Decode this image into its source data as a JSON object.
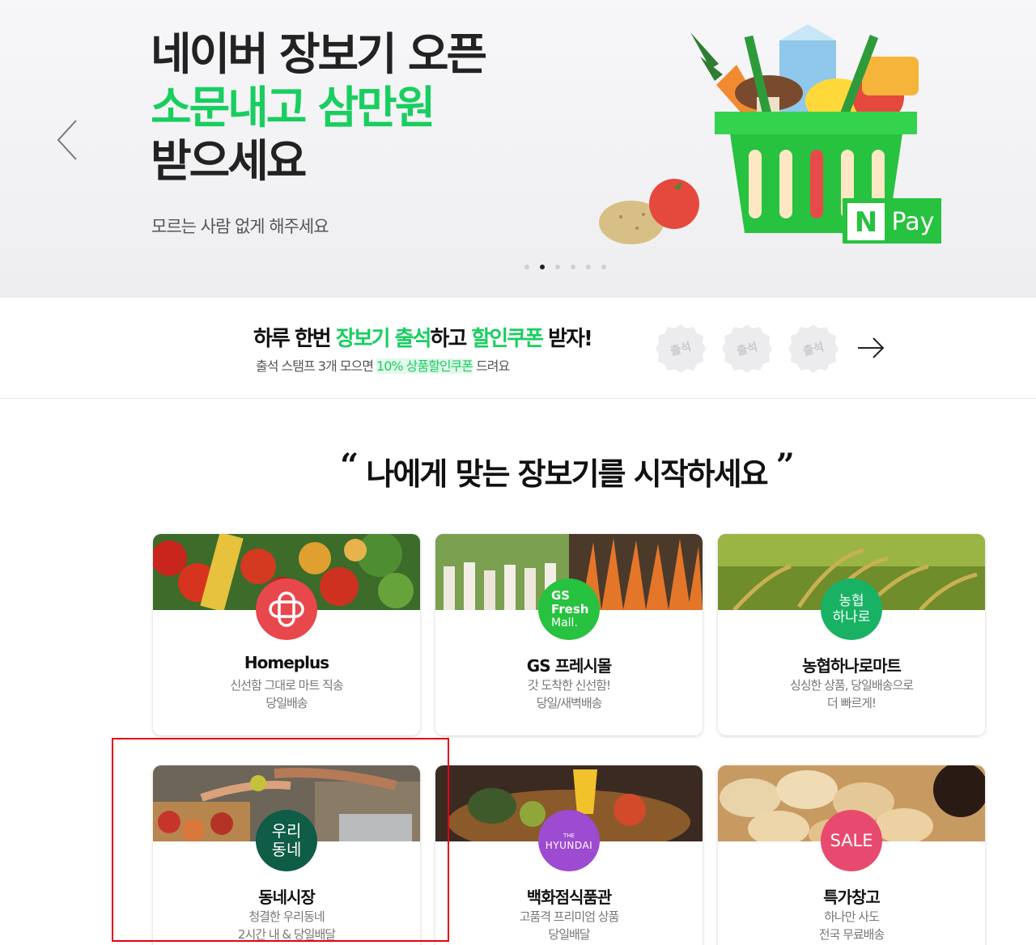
{
  "hero": {
    "line1": "네이버 장보기 오픈",
    "line2": "소문내고 삼만원",
    "line3": "받으세요",
    "subtitle": "모르는 사람 없게 해주세요",
    "badge_n": "N",
    "badge_pay": "Pay",
    "slides_total": 6,
    "slide_active": 2
  },
  "attendance": {
    "title_pre": "하루 한번 ",
    "title_green1": "장보기 출석",
    "title_mid": "하고 ",
    "title_green2": "할인쿠폰",
    "title_post": " 받자!",
    "desc_pre": "출석 스탬프 3개 모으면 ",
    "desc_highlight": "10% 상품할인쿠폰",
    "desc_post": " 드려요",
    "stamps": [
      "출석",
      "출석",
      "출석"
    ]
  },
  "section": {
    "open_quote": "“",
    "title": "나에게 맞는 장보기를 시작하세요",
    "close_quote": "”"
  },
  "cards": [
    {
      "name": "Homeplus",
      "desc1": "신선함 그대로 마트 직송",
      "desc2": "당일배송",
      "logo_color": "#e8474c"
    },
    {
      "name": "GS 프레시몰",
      "desc1": "갓 도착한 신선함!",
      "desc2": "당일/새벽배송",
      "logo_text1": "GS",
      "logo_text2": "Fresh",
      "logo_text3": "Mall.",
      "logo_color": "#27c23f"
    },
    {
      "name": "농협하나로마트",
      "desc1": "싱싱한 상품, 당일배송으로",
      "desc2": "더 빠르게!",
      "logo_text1": "농협",
      "logo_text2": "하나로",
      "logo_color": "#19b265"
    },
    {
      "name": "동네시장",
      "desc1": "청결한 우리동네",
      "desc2": "2시간 내 & 당일배달",
      "logo_text1": "우리",
      "logo_text2": "동네",
      "logo_color": "#0f5c47"
    },
    {
      "name": "백화점식품관",
      "desc1": "고품격 프리미엄 상품",
      "desc2": "당일배달",
      "logo_text1": "THE",
      "logo_text2": "HYUNDAI",
      "logo_color": "#9d4bd0"
    },
    {
      "name": "특가창고",
      "desc1": "하나만 사도",
      "desc2": "전국 무료배송",
      "logo_text1": "SALE",
      "logo_color": "#e84a6f"
    }
  ],
  "colors": {
    "accent_green": "#19ce60",
    "highlight_red": "#e60012"
  }
}
